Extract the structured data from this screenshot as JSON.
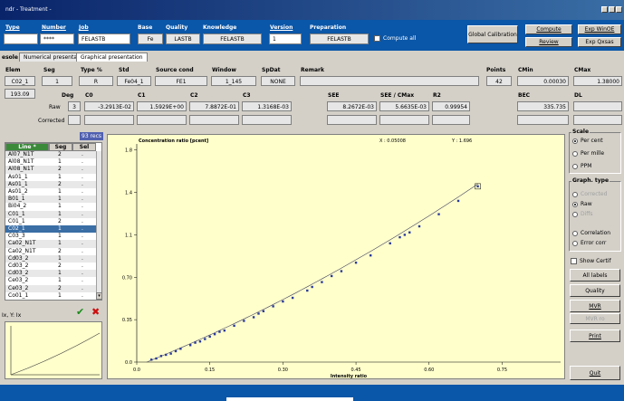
{
  "window": {
    "title": "ndr - Treatment -"
  },
  "header": {
    "type_label": "Type",
    "number_label": "Number",
    "job_label": "Job",
    "base_label": "Base",
    "quality_label": "Quality",
    "knowledge_label": "Knowledge",
    "version_label": "Version",
    "preparation_label": "Preparation",
    "type_value": "",
    "number_value": "****",
    "job_value": "FELASTB",
    "base_value": "Fe",
    "quality_value": "LASTB",
    "knowledge_value": "FELASTB",
    "version_value": "1",
    "preparation_value": "FELASTB",
    "compute_all_label": "Compute all",
    "global_calibration": "Global Calibration",
    "compute": "Compute",
    "exp_winoe": "Exp WinOE",
    "review": "Review",
    "exp_qxsas": "Exp Qxsas"
  },
  "tabs": {
    "prefix": "esole",
    "numerical": "Numerical presentation",
    "graphical": "Graphical presentation"
  },
  "table_head": {
    "elem": "Elem",
    "seg": "Seg",
    "type": "Type %",
    "std": "Std",
    "source": "Source cond",
    "window": "Window",
    "spdat": "SpDat",
    "remark": "Remark",
    "points": "Points",
    "cmin": "CMin",
    "cmax": "CMax"
  },
  "table_row": {
    "elem": "C02_1",
    "seg": "1",
    "type": "R",
    "std": "Fe04_1",
    "source": "FE1",
    "window": "1_145",
    "spdat": "NONE",
    "remark": "",
    "points": "42",
    "cmin": "0.00030",
    "cmax": "1.38000",
    "extra": "193.09"
  },
  "coef": {
    "deg_label": "Deg",
    "c0": "C0",
    "c1": "C1",
    "c2": "C2",
    "c3": "C3",
    "see": "SEE",
    "see_cmax": "SEE / CMax",
    "r2": "R2",
    "bec": "BEC",
    "dl": "DL",
    "raw_label": "Raw",
    "corrected_label": "Corrected",
    "deg": "3",
    "c0v": "-3.2913E-02",
    "c1v": "1.5929E+00",
    "c2v": "7.8872E-01",
    "c3v": "1.3168E-03",
    "seev": "8.2672E-03",
    "see_cmaxv": "5.6635E-03",
    "r2v": "0.99954",
    "becv": "335.735",
    "dlv": ""
  },
  "list": {
    "recs": "93 recs",
    "col_line": "Line *",
    "col_seg": "Seg",
    "col_sel": "Sel",
    "rows": [
      {
        "line": "Al07_N1T",
        "seg": "2",
        "sel": "."
      },
      {
        "line": "Al08_N1T",
        "seg": "1",
        "sel": "."
      },
      {
        "line": "Al08_N1T",
        "seg": "2",
        "sel": "."
      },
      {
        "line": "As01_1",
        "seg": "1",
        "sel": "."
      },
      {
        "line": "As01_1",
        "seg": "2",
        "sel": "."
      },
      {
        "line": "As01_2",
        "seg": "1",
        "sel": "."
      },
      {
        "line": "B01_1",
        "seg": "1",
        "sel": "."
      },
      {
        "line": "Bi04_2",
        "seg": "1",
        "sel": "."
      },
      {
        "line": "C01_1",
        "seg": "1",
        "sel": "."
      },
      {
        "line": "C01_1",
        "seg": "2",
        "sel": "."
      },
      {
        "line": "C02_1",
        "seg": "1",
        "sel": "."
      },
      {
        "line": "C03_3",
        "seg": "1",
        "sel": "."
      },
      {
        "line": "Ca02_N1T",
        "seg": "1",
        "sel": "."
      },
      {
        "line": "Ca02_N1T",
        "seg": "2",
        "sel": "."
      },
      {
        "line": "Cd03_2",
        "seg": "1",
        "sel": "."
      },
      {
        "line": "Cd03_2",
        "seg": "2",
        "sel": "."
      },
      {
        "line": "Cd03_2",
        "seg": "1",
        "sel": "."
      },
      {
        "line": "Ce03_2",
        "seg": "1",
        "sel": "."
      },
      {
        "line": "Ce03_2",
        "seg": "2",
        "sel": "."
      },
      {
        "line": "Co01_1",
        "seg": "1",
        "sel": "."
      }
    ]
  },
  "mini_label": "Ix, Y: Ix",
  "scale": {
    "title": "Scale",
    "per_cent": "Per cent",
    "per_mille": "Per mille",
    "ppm": "PPM"
  },
  "graph_type": {
    "title": "Graph. type",
    "corrected": "Corrected",
    "raw": "Raw",
    "diffs": "Diffs",
    "correlation": "Correlation",
    "error_corr": "Error corr"
  },
  "show_certif": "Show Certif",
  "buttons": {
    "all_labels": "All labels",
    "quality": "Quality",
    "mvr": "MVR",
    "mvr_ro": "MVR ro",
    "print": "Print",
    "quit": "Quit"
  },
  "colors": {
    "header": "#0a56a8",
    "chart_bg": "#ffffcc",
    "selection": "#3a6ea5",
    "points": "#2a3a9a"
  },
  "chart_data": {
    "type": "scatter",
    "title": "Concentration ratio [pcent]",
    "xlabel": "Intensity ratio",
    "x_readout": "X : 0.05008",
    "y_readout": "Y : 1.696",
    "xlim": [
      0,
      0.87
    ],
    "ylim": [
      0,
      1.8
    ],
    "x_ticks": [
      "0.0",
      "0.15",
      "0.30",
      "0.45",
      "0.60",
      "0.75"
    ],
    "y_ticks": [
      "0.0",
      "0.35",
      "0.70",
      "1.1",
      "1.4",
      "1.8"
    ],
    "fit": {
      "c0": -0.032913,
      "c1": 1.5929,
      "c2": 0.78872,
      "c3": 0.0013168
    },
    "points": [
      [
        0.03,
        0.02
      ],
      [
        0.04,
        0.03
      ],
      [
        0.05,
        0.05
      ],
      [
        0.06,
        0.06
      ],
      [
        0.07,
        0.07
      ],
      [
        0.08,
        0.09
      ],
      [
        0.09,
        0.11
      ],
      [
        0.11,
        0.14
      ],
      [
        0.12,
        0.16
      ],
      [
        0.13,
        0.17
      ],
      [
        0.14,
        0.19
      ],
      [
        0.15,
        0.21
      ],
      [
        0.16,
        0.23
      ],
      [
        0.17,
        0.25
      ],
      [
        0.18,
        0.26
      ],
      [
        0.2,
        0.3
      ],
      [
        0.22,
        0.34
      ],
      [
        0.24,
        0.37
      ],
      [
        0.25,
        0.4
      ],
      [
        0.26,
        0.42
      ],
      [
        0.28,
        0.46
      ],
      [
        0.3,
        0.5
      ],
      [
        0.32,
        0.53
      ],
      [
        0.35,
        0.59
      ],
      [
        0.36,
        0.62
      ],
      [
        0.38,
        0.66
      ],
      [
        0.4,
        0.71
      ],
      [
        0.42,
        0.75
      ],
      [
        0.45,
        0.82
      ],
      [
        0.48,
        0.88
      ],
      [
        0.52,
        0.98
      ],
      [
        0.54,
        1.03
      ],
      [
        0.55,
        1.05
      ],
      [
        0.56,
        1.07
      ],
      [
        0.58,
        1.12
      ],
      [
        0.62,
        1.22
      ],
      [
        0.66,
        1.33
      ],
      [
        0.7,
        1.45
      ]
    ]
  }
}
